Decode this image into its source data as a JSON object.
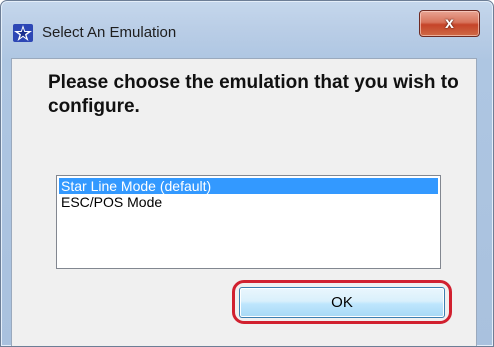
{
  "window": {
    "title": "Select An Emulation",
    "close_label": "x",
    "icon": "star-logo-icon"
  },
  "dialog": {
    "prompt": "Please choose the emulation that you wish to configure.",
    "options": [
      {
        "label": "Star Line Mode (default)",
        "selected": true
      },
      {
        "label": "ESC/POS Mode",
        "selected": false
      }
    ],
    "ok_label": "OK"
  },
  "colors": {
    "selection": "#3399ff",
    "highlight_ring": "#d1202f",
    "close_button": "#c54429"
  }
}
